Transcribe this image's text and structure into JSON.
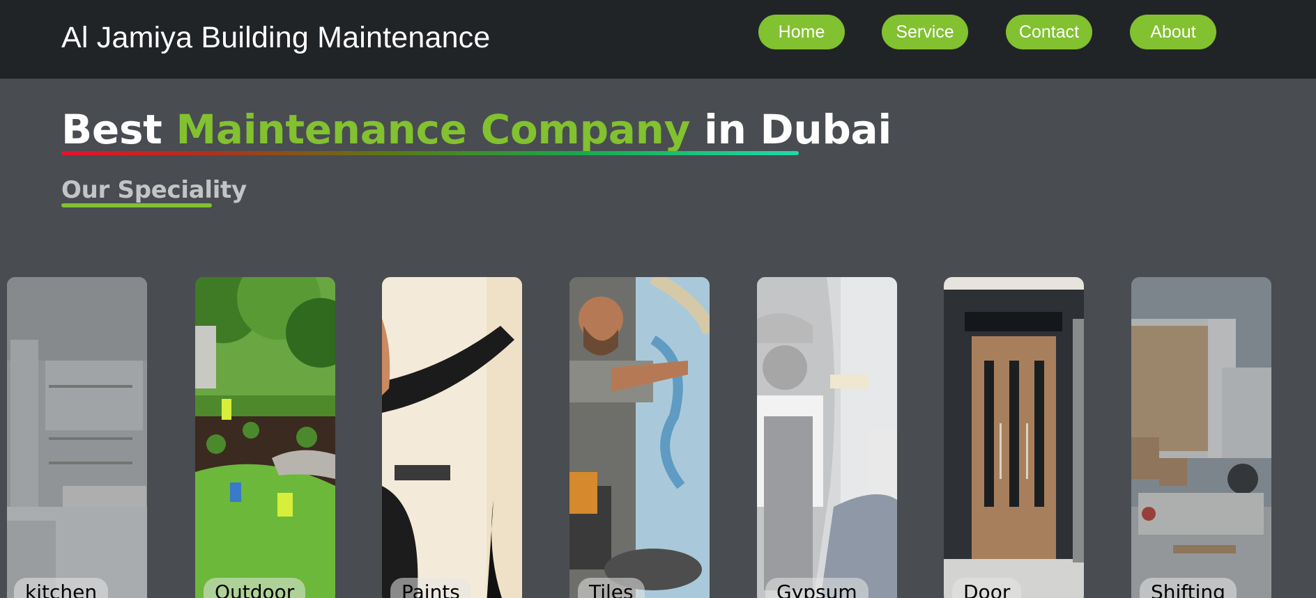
{
  "header": {
    "brand": "Al Jamiya Building Maintenance",
    "nav": [
      {
        "label": "Home"
      },
      {
        "label": "Service"
      },
      {
        "label": "Contact"
      },
      {
        "label": "About"
      }
    ]
  },
  "hero": {
    "title_part1": "Best ",
    "title_accent": "Maintenance Company",
    "title_part2": " in Dubai",
    "subtitle": "Our Speciality"
  },
  "services": [
    {
      "label": "kitchen",
      "icon": "kitchen-image"
    },
    {
      "label": "Outdoor",
      "icon": "landscaping-image"
    },
    {
      "label": "Paints",
      "icon": "painting-image"
    },
    {
      "label": "Tiles",
      "icon": "tiling-image"
    },
    {
      "label": "Gypsum",
      "icon": "gypsum-image"
    },
    {
      "label": "Door",
      "icon": "door-image"
    },
    {
      "label": "Shifting",
      "icon": "moving-truck-image"
    }
  ],
  "colors": {
    "accent": "#82c12f",
    "navbar": "#212427",
    "background": "#494c51"
  }
}
